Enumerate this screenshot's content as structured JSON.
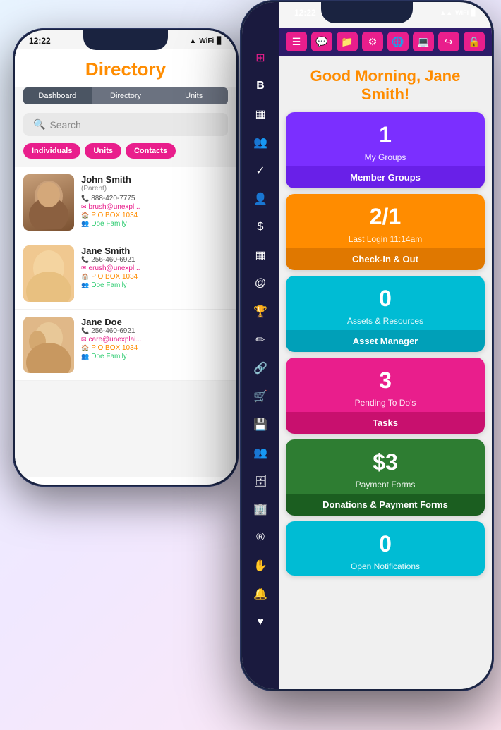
{
  "leftPhone": {
    "time": "12:22",
    "title": "Directory",
    "navTabs": [
      {
        "label": "Dashboard",
        "active": false
      },
      {
        "label": "Directory",
        "active": true
      },
      {
        "label": "Units",
        "active": false
      }
    ],
    "search": {
      "placeholder": "Search"
    },
    "filters": [
      {
        "label": "Individuals"
      },
      {
        "label": "Units"
      },
      {
        "label": "Contacts"
      }
    ],
    "contacts": [
      {
        "name": "John Smith",
        "role": "(Parent)",
        "phone": "888-420-7775",
        "email": "brush@unexpl...",
        "address": "P O BOX 1034",
        "family": "Doe Family"
      },
      {
        "name": "Jane Smith",
        "phone": "256-460-6921",
        "email": "erush@unexpl...",
        "address": "P O BOX 1034",
        "family": "Doe Family"
      },
      {
        "name": "Jane Doe",
        "phone": "256-460-6921",
        "email": "care@unexplai...",
        "address": "P O BOX 1034",
        "family": "Doe Family"
      }
    ]
  },
  "rightPhone": {
    "time": "12:22",
    "greeting": "Good Morning, Jane Smith!",
    "cards": [
      {
        "color": "purple",
        "value": "1",
        "sub": "My Groups",
        "bottom": "Member Groups"
      },
      {
        "color": "orange",
        "value": "2/1",
        "sub": "Last Login 11:14am",
        "bottom": "Check-In & Out"
      },
      {
        "color": "teal",
        "value": "0",
        "sub": "Assets & Resources",
        "bottom": "Asset Manager"
      },
      {
        "color": "pink",
        "value": "3",
        "sub": "Pending To Do's",
        "bottom": "Tasks"
      },
      {
        "color": "green",
        "value": "$3",
        "sub": "Payment Forms",
        "bottom": "Donations & Payment Forms"
      },
      {
        "color": "cyan",
        "value": "0",
        "sub": "Open Notifications",
        "bottom": ""
      }
    ],
    "sidebarIcons": [
      "⊞",
      "B",
      "▦",
      "👥",
      "✓",
      "👤",
      "$",
      "▦",
      "@",
      "🏆",
      "✏",
      "🔗",
      "🛒",
      "💾",
      "👥",
      "💾",
      "🏢",
      "®",
      "✋",
      "🔔",
      "♥"
    ],
    "topIcons": [
      "☰",
      "💬",
      "📁",
      "⚙",
      "🌐",
      "💻",
      "↪",
      "🔒"
    ]
  }
}
